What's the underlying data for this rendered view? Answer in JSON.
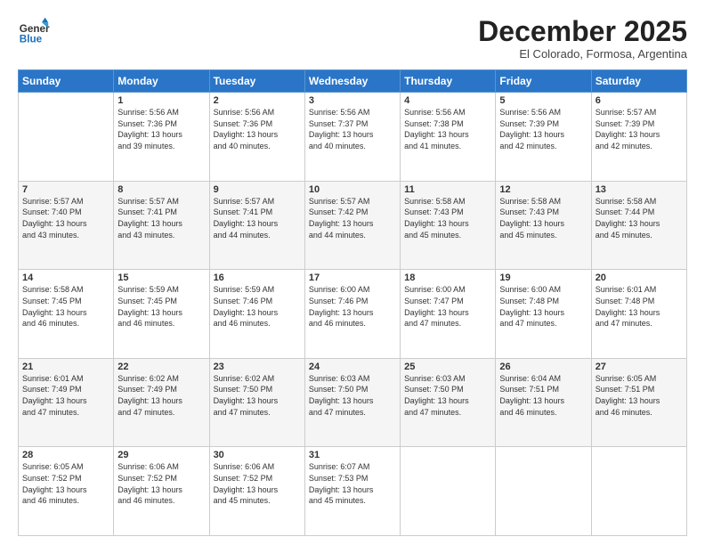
{
  "header": {
    "logo": {
      "general": "General",
      "blue": "Blue"
    },
    "title": "December 2025",
    "subtitle": "El Colorado, Formosa, Argentina"
  },
  "weekdays": [
    "Sunday",
    "Monday",
    "Tuesday",
    "Wednesday",
    "Thursday",
    "Friday",
    "Saturday"
  ],
  "weeks": [
    [
      {
        "day": "",
        "sunrise": "",
        "sunset": "",
        "daylight": ""
      },
      {
        "day": "1",
        "sunrise": "Sunrise: 5:56 AM",
        "sunset": "Sunset: 7:36 PM",
        "daylight": "Daylight: 13 hours and 39 minutes."
      },
      {
        "day": "2",
        "sunrise": "Sunrise: 5:56 AM",
        "sunset": "Sunset: 7:36 PM",
        "daylight": "Daylight: 13 hours and 40 minutes."
      },
      {
        "day": "3",
        "sunrise": "Sunrise: 5:56 AM",
        "sunset": "Sunset: 7:37 PM",
        "daylight": "Daylight: 13 hours and 40 minutes."
      },
      {
        "day": "4",
        "sunrise": "Sunrise: 5:56 AM",
        "sunset": "Sunset: 7:38 PM",
        "daylight": "Daylight: 13 hours and 41 minutes."
      },
      {
        "day": "5",
        "sunrise": "Sunrise: 5:56 AM",
        "sunset": "Sunset: 7:39 PM",
        "daylight": "Daylight: 13 hours and 42 minutes."
      },
      {
        "day": "6",
        "sunrise": "Sunrise: 5:57 AM",
        "sunset": "Sunset: 7:39 PM",
        "daylight": "Daylight: 13 hours and 42 minutes."
      }
    ],
    [
      {
        "day": "7",
        "sunrise": "Sunrise: 5:57 AM",
        "sunset": "Sunset: 7:40 PM",
        "daylight": "Daylight: 13 hours and 43 minutes."
      },
      {
        "day": "8",
        "sunrise": "Sunrise: 5:57 AM",
        "sunset": "Sunset: 7:41 PM",
        "daylight": "Daylight: 13 hours and 43 minutes."
      },
      {
        "day": "9",
        "sunrise": "Sunrise: 5:57 AM",
        "sunset": "Sunset: 7:41 PM",
        "daylight": "Daylight: 13 hours and 44 minutes."
      },
      {
        "day": "10",
        "sunrise": "Sunrise: 5:57 AM",
        "sunset": "Sunset: 7:42 PM",
        "daylight": "Daylight: 13 hours and 44 minutes."
      },
      {
        "day": "11",
        "sunrise": "Sunrise: 5:58 AM",
        "sunset": "Sunset: 7:43 PM",
        "daylight": "Daylight: 13 hours and 45 minutes."
      },
      {
        "day": "12",
        "sunrise": "Sunrise: 5:58 AM",
        "sunset": "Sunset: 7:43 PM",
        "daylight": "Daylight: 13 hours and 45 minutes."
      },
      {
        "day": "13",
        "sunrise": "Sunrise: 5:58 AM",
        "sunset": "Sunset: 7:44 PM",
        "daylight": "Daylight: 13 hours and 45 minutes."
      }
    ],
    [
      {
        "day": "14",
        "sunrise": "Sunrise: 5:58 AM",
        "sunset": "Sunset: 7:45 PM",
        "daylight": "Daylight: 13 hours and 46 minutes."
      },
      {
        "day": "15",
        "sunrise": "Sunrise: 5:59 AM",
        "sunset": "Sunset: 7:45 PM",
        "daylight": "Daylight: 13 hours and 46 minutes."
      },
      {
        "day": "16",
        "sunrise": "Sunrise: 5:59 AM",
        "sunset": "Sunset: 7:46 PM",
        "daylight": "Daylight: 13 hours and 46 minutes."
      },
      {
        "day": "17",
        "sunrise": "Sunrise: 6:00 AM",
        "sunset": "Sunset: 7:46 PM",
        "daylight": "Daylight: 13 hours and 46 minutes."
      },
      {
        "day": "18",
        "sunrise": "Sunrise: 6:00 AM",
        "sunset": "Sunset: 7:47 PM",
        "daylight": "Daylight: 13 hours and 47 minutes."
      },
      {
        "day": "19",
        "sunrise": "Sunrise: 6:00 AM",
        "sunset": "Sunset: 7:48 PM",
        "daylight": "Daylight: 13 hours and 47 minutes."
      },
      {
        "day": "20",
        "sunrise": "Sunrise: 6:01 AM",
        "sunset": "Sunset: 7:48 PM",
        "daylight": "Daylight: 13 hours and 47 minutes."
      }
    ],
    [
      {
        "day": "21",
        "sunrise": "Sunrise: 6:01 AM",
        "sunset": "Sunset: 7:49 PM",
        "daylight": "Daylight: 13 hours and 47 minutes."
      },
      {
        "day": "22",
        "sunrise": "Sunrise: 6:02 AM",
        "sunset": "Sunset: 7:49 PM",
        "daylight": "Daylight: 13 hours and 47 minutes."
      },
      {
        "day": "23",
        "sunrise": "Sunrise: 6:02 AM",
        "sunset": "Sunset: 7:50 PM",
        "daylight": "Daylight: 13 hours and 47 minutes."
      },
      {
        "day": "24",
        "sunrise": "Sunrise: 6:03 AM",
        "sunset": "Sunset: 7:50 PM",
        "daylight": "Daylight: 13 hours and 47 minutes."
      },
      {
        "day": "25",
        "sunrise": "Sunrise: 6:03 AM",
        "sunset": "Sunset: 7:50 PM",
        "daylight": "Daylight: 13 hours and 47 minutes."
      },
      {
        "day": "26",
        "sunrise": "Sunrise: 6:04 AM",
        "sunset": "Sunset: 7:51 PM",
        "daylight": "Daylight: 13 hours and 46 minutes."
      },
      {
        "day": "27",
        "sunrise": "Sunrise: 6:05 AM",
        "sunset": "Sunset: 7:51 PM",
        "daylight": "Daylight: 13 hours and 46 minutes."
      }
    ],
    [
      {
        "day": "28",
        "sunrise": "Sunrise: 6:05 AM",
        "sunset": "Sunset: 7:52 PM",
        "daylight": "Daylight: 13 hours and 46 minutes."
      },
      {
        "day": "29",
        "sunrise": "Sunrise: 6:06 AM",
        "sunset": "Sunset: 7:52 PM",
        "daylight": "Daylight: 13 hours and 46 minutes."
      },
      {
        "day": "30",
        "sunrise": "Sunrise: 6:06 AM",
        "sunset": "Sunset: 7:52 PM",
        "daylight": "Daylight: 13 hours and 45 minutes."
      },
      {
        "day": "31",
        "sunrise": "Sunrise: 6:07 AM",
        "sunset": "Sunset: 7:53 PM",
        "daylight": "Daylight: 13 hours and 45 minutes."
      },
      {
        "day": "",
        "sunrise": "",
        "sunset": "",
        "daylight": ""
      },
      {
        "day": "",
        "sunrise": "",
        "sunset": "",
        "daylight": ""
      },
      {
        "day": "",
        "sunrise": "",
        "sunset": "",
        "daylight": ""
      }
    ]
  ]
}
